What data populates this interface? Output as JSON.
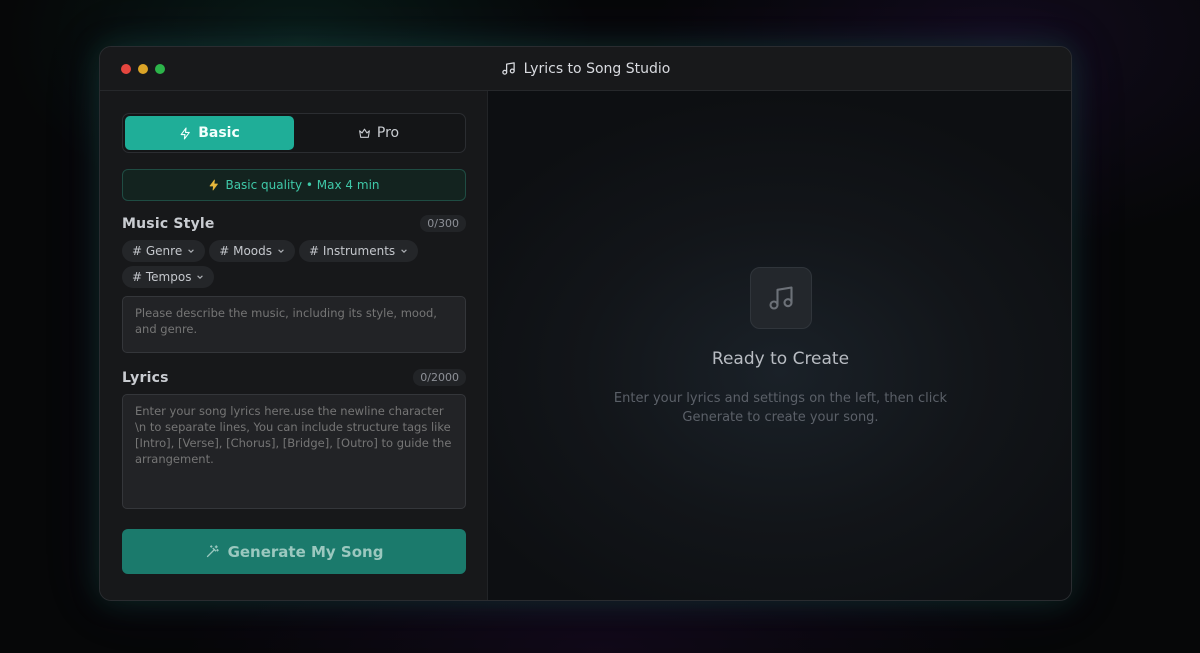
{
  "window": {
    "title": "Lyrics to Song Studio"
  },
  "mode": {
    "basic_label": "Basic",
    "pro_label": "Pro",
    "active": "Basic"
  },
  "quality_banner": "Basic quality • Max 4 min",
  "music_style": {
    "title": "Music Style",
    "counter": "0/300",
    "tags": [
      {
        "label": "# Genre"
      },
      {
        "label": "# Moods"
      },
      {
        "label": "# Instruments"
      },
      {
        "label": "# Tempos"
      }
    ],
    "placeholder": "Please describe the music, including its style, mood, and genre."
  },
  "lyrics": {
    "title": "Lyrics",
    "counter": "0/2000",
    "placeholder": "Enter your song lyrics here.use the newline character \\n to separate lines, You can include structure tags like [Intro], [Verse], [Chorus], [Bridge], [Outro] to guide the arrangement."
  },
  "generate_label": "Generate My Song",
  "preview": {
    "title": "Ready to Create",
    "subtitle": "Enter your lyrics and settings on the left, then click Generate to create your song."
  },
  "colors": {
    "accent": "#1fae98",
    "generate_bg": "#1b7a6c",
    "banner_text": "#3fc9a9"
  }
}
